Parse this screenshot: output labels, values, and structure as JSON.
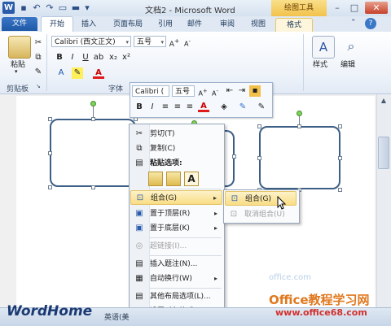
{
  "title_bar": {
    "title": "文档2 - Microsoft Word",
    "contextual_tab": "绘图工具",
    "word_logo": "W"
  },
  "tabs": [
    {
      "label": "文件"
    },
    {
      "label": "开始"
    },
    {
      "label": "插入"
    },
    {
      "label": "页面布局"
    },
    {
      "label": "引用"
    },
    {
      "label": "邮件"
    },
    {
      "label": "审阅"
    },
    {
      "label": "视图"
    },
    {
      "label": "格式"
    }
  ],
  "ribbon": {
    "paste_label": "粘贴",
    "clipboard_group": "剪贴板",
    "font_group": "字体",
    "font_name": "Calibri (西文正文)",
    "font_size": "五号",
    "style_label": "样式",
    "edit_label": "编辑",
    "bold": "B",
    "italic": "I",
    "underline": "U"
  },
  "mini_toolbar": {
    "font_name": "Calibri (",
    "font_size": "五号",
    "bold": "B",
    "italic": "I",
    "font_color": "A",
    "highlight": "A"
  },
  "context_menu": {
    "items": [
      {
        "label": "剪切(T)",
        "icon": "scissors-icon",
        "glyph": "✂"
      },
      {
        "label": "复制(C)",
        "icon": "copy-icon",
        "glyph": "⧉"
      },
      {
        "label": "粘贴选项:",
        "icon": "paste-icon",
        "glyph": "📋"
      },
      {
        "label": "组合(G)",
        "icon": "group-icon",
        "glyph": "⊡"
      },
      {
        "label": "置于顶层(R)",
        "icon": "bring-front-icon",
        "glyph": "▣"
      },
      {
        "label": "置于底层(K)",
        "icon": "send-back-icon",
        "glyph": "▣"
      },
      {
        "label": "超链接(I)...",
        "icon": "hyperlink-icon",
        "glyph": "◎"
      },
      {
        "label": "插入题注(N)...",
        "icon": "caption-icon",
        "glyph": "▤"
      },
      {
        "label": "自动换行(W)",
        "icon": "wrap-icon",
        "glyph": "▦"
      },
      {
        "label": "其他布局选项(L)...",
        "icon": "layout-icon",
        "glyph": "▤"
      },
      {
        "label": "设置对象格式(O)...",
        "icon": "format-object-icon",
        "glyph": "▤"
      }
    ],
    "paste_glyph": "A"
  },
  "submenu": {
    "items": [
      {
        "label": "组合(G)"
      },
      {
        "label": "取消组合(U)"
      }
    ]
  },
  "status_bar": {
    "language": "英语(美"
  },
  "watermarks": {
    "left": "WordHome",
    "right_brand": "Office教程学习网",
    "right_url": "www.office68.com",
    "faint": "office.com"
  },
  "colors": {
    "accent": "#2b579a",
    "highlight": "#f9dd86",
    "shape_border": "#3d5f85"
  }
}
